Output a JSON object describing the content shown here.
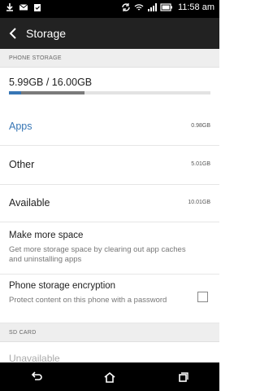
{
  "status_bar": {
    "time": "11:58 am",
    "left_icons": [
      "download-icon",
      "gmail-icon",
      "clipboard-check-icon"
    ],
    "right_icons": [
      "sync-icon",
      "wifi-icon",
      "signal-icon",
      "battery-icon"
    ]
  },
  "action_bar": {
    "title": "Storage"
  },
  "phone_storage": {
    "header": "PHONE STORAGE",
    "summary": "5.99GB / 16.00GB",
    "used_fraction": 0.374,
    "apps_fraction": 0.061,
    "rows": [
      {
        "label": "Apps",
        "value": "0.98GB"
      },
      {
        "label": "Other",
        "value": "5.01GB"
      },
      {
        "label": "Available",
        "value": "10.01GB"
      }
    ],
    "make_more_space": {
      "title": "Make more space",
      "subtitle": "Get more storage space by clearing out app caches and uninstalling apps"
    },
    "encryption": {
      "title": "Phone storage encryption",
      "subtitle": "Protect content on this phone with a password",
      "checked": false
    }
  },
  "sd_card": {
    "header": "SD CARD",
    "status": "Unavailable"
  },
  "colors": {
    "accent": "#3776b5",
    "bar_other": "#7b7b7b",
    "bar_bg": "#e3e3e3"
  },
  "nav_icons": [
    "back-icon",
    "home-icon",
    "recents-icon"
  ]
}
